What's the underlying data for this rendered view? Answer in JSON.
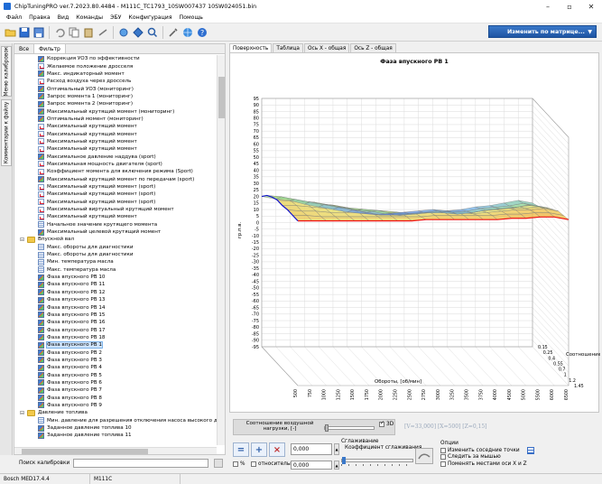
{
  "window": {
    "title": "ChipTuningPRO ver.7.2023.80.4484 - M111C_TC1793_10SW007437 10SW024051.bin"
  },
  "menu": [
    "Файл",
    "Правка",
    "Вид",
    "Команды",
    "ЭБУ",
    "Конфигурация",
    "Помощь"
  ],
  "toolbar": {
    "matrix_button": "Изменить по матрице...",
    "icons": [
      "open-folder-icon",
      "save-icon",
      "save-as-icon",
      "undo-icon",
      "copy-icon",
      "paste-icon",
      "export-icon",
      "compare-icon",
      "checksum-icon",
      "zoom-icon",
      "tools-icon",
      "browser-icon",
      "help-icon"
    ]
  },
  "left_sidebar_tabs": [
    "Меню калибровок",
    "Комментарии к файлу"
  ],
  "left_panel": {
    "tabs": [
      "Все",
      "Фильтр"
    ],
    "search_label": "Поиск калибровки",
    "tree": [
      {
        "label": "Коррекция УОЗ по эффективности",
        "icon": "map",
        "indent": 1
      },
      {
        "label": "Желаемое положение дросселя",
        "icon": "curve",
        "indent": 1
      },
      {
        "label": "Макс. индикаторный момент",
        "icon": "map",
        "indent": 1
      },
      {
        "label": "Расход воздуха через дроссель",
        "icon": "curve",
        "indent": 1
      },
      {
        "label": "Оптимальный УОЗ  (мониторинг)",
        "icon": "map",
        "indent": 1
      },
      {
        "label": "Запрос момента 1 (мониторинг)",
        "icon": "map",
        "indent": 1
      },
      {
        "label": "Запрос момента 2 (мониторинг)",
        "icon": "map",
        "indent": 1
      },
      {
        "label": "Максимальный крутящий момент (мониторинг)",
        "icon": "map",
        "indent": 1
      },
      {
        "label": "Оптимальный момент  (мониторинг)",
        "icon": "map",
        "indent": 1
      },
      {
        "label": "Максимальный крутящий момент",
        "icon": "curve",
        "indent": 1
      },
      {
        "label": "Максимальный крутящий момент",
        "icon": "curve",
        "indent": 1
      },
      {
        "label": "Максимальный крутящий момент",
        "icon": "curve",
        "indent": 1
      },
      {
        "label": "Максимальный крутящий момент",
        "icon": "curve",
        "indent": 1
      },
      {
        "label": "Максимальное давление наддува (sport)",
        "icon": "map",
        "indent": 1
      },
      {
        "label": "Максимальная мощность двигателя (sport)",
        "icon": "curve",
        "indent": 1
      },
      {
        "label": "Коэффициент момента для включения режима (Sport)",
        "icon": "curve",
        "indent": 1
      },
      {
        "label": "Максимальный крутящий момент по передачам (sport)",
        "icon": "map",
        "indent": 1
      },
      {
        "label": "Максимальный крутящий момент (sport)",
        "icon": "curve",
        "indent": 1
      },
      {
        "label": "Максимальный крутящий момент (sport)",
        "icon": "curve",
        "indent": 1
      },
      {
        "label": "Максимальный крутящий момент (sport)",
        "icon": "curve",
        "indent": 1
      },
      {
        "label": "Максимальный виртуальный крутящий момент",
        "icon": "curve",
        "indent": 1
      },
      {
        "label": "Максимальный крутящий момент",
        "icon": "curve",
        "indent": 1
      },
      {
        "label": "Начальное значение крутящего момента",
        "icon": "table",
        "indent": 1
      },
      {
        "label": "Максимальный целевой крутящий момент",
        "icon": "map",
        "indent": 1
      },
      {
        "label": "Впускной вал",
        "icon": "folder",
        "indent": 0
      },
      {
        "label": "Макс. обороты для диагностики",
        "icon": "table",
        "indent": 1
      },
      {
        "label": "Макс. обороты для диагностики",
        "icon": "table",
        "indent": 1
      },
      {
        "label": "Мин. температура масла",
        "icon": "table",
        "indent": 1
      },
      {
        "label": "Макс. температура масла",
        "icon": "table",
        "indent": 1
      },
      {
        "label": "Фаза впускного РВ 10",
        "icon": "map",
        "indent": 1
      },
      {
        "label": "Фаза впускного РВ 11",
        "icon": "map",
        "indent": 1
      },
      {
        "label": "Фаза впускного РВ 12",
        "icon": "map",
        "indent": 1
      },
      {
        "label": "Фаза впускного РВ 13",
        "icon": "map",
        "indent": 1
      },
      {
        "label": "Фаза впускного РВ 14",
        "icon": "map",
        "indent": 1
      },
      {
        "label": "Фаза впускного РВ 15",
        "icon": "map",
        "indent": 1
      },
      {
        "label": "Фаза впускного РВ 16",
        "icon": "map",
        "indent": 1
      },
      {
        "label": "Фаза впускного РВ 17",
        "icon": "map",
        "indent": 1
      },
      {
        "label": "Фаза впускного РВ 18",
        "icon": "map",
        "indent": 1
      },
      {
        "label": "Фаза впускного РВ 1",
        "icon": "map",
        "indent": 1,
        "selected": true
      },
      {
        "label": "Фаза впускного РВ 2",
        "icon": "map",
        "indent": 1
      },
      {
        "label": "Фаза впускного РВ 3",
        "icon": "map",
        "indent": 1
      },
      {
        "label": "Фаза впускного РВ 4",
        "icon": "map",
        "indent": 1
      },
      {
        "label": "Фаза впускного РВ 5",
        "icon": "map",
        "indent": 1
      },
      {
        "label": "Фаза впускного РВ 6",
        "icon": "map",
        "indent": 1
      },
      {
        "label": "Фаза впускного РВ 7",
        "icon": "map",
        "indent": 1
      },
      {
        "label": "Фаза впускного РВ 8",
        "icon": "map",
        "indent": 1
      },
      {
        "label": "Фаза впускного РВ 9",
        "icon": "map",
        "indent": 1
      },
      {
        "label": "Давление топлива",
        "icon": "folder",
        "indent": 0
      },
      {
        "label": "Мин. давление для разрешения отключения насоса высокого да",
        "icon": "table",
        "indent": 1
      },
      {
        "label": "Заданное давление топлива 10",
        "icon": "map",
        "indent": 1
      },
      {
        "label": "Заданное давление топлива 11",
        "icon": "map",
        "indent": 1
      }
    ]
  },
  "view_tabs": [
    "Поверхность",
    "Таблица",
    "Ось X - общая",
    "Ось Z - общая"
  ],
  "chart": {
    "title": "Фаза впускного РВ 1",
    "y_label": "гр.п.в.",
    "x_label": "Обороты, [об/мин]",
    "z_label": "Соотношение в",
    "y_ticks": [
      "95",
      "90",
      "85",
      "80",
      "75",
      "70",
      "65",
      "60",
      "55",
      "50",
      "45",
      "40",
      "35",
      "30",
      "25",
      "20",
      "15",
      "10",
      "5",
      "0",
      "-5",
      "-10",
      "-15",
      "-20",
      "-25",
      "-30",
      "-35",
      "-40",
      "-45",
      "-50",
      "-55",
      "-60",
      "-65",
      "-70",
      "-75",
      "-80",
      "-85",
      "-90",
      "-95"
    ],
    "x_ticks": [
      "500",
      "750",
      "1000",
      "1250",
      "1500",
      "1750",
      "2000",
      "2250",
      "2500",
      "2750",
      "3000",
      "3250",
      "3500",
      "3750",
      "4000",
      "4500",
      "5000",
      "5500",
      "6000",
      "6500"
    ],
    "z_ticks": [
      "1.45",
      "1.2",
      "1",
      "0.7",
      "0.55",
      "0.4",
      "0.25",
      "0.15"
    ]
  },
  "chart_data": {
    "type": "surface",
    "title": "Фаза впускного РВ 1",
    "xlabel": "Обороты, [об/мин]",
    "ylabel": "гр.п.в.",
    "zlabel": "Соотношение в",
    "x": [
      500,
      750,
      1000,
      1250,
      1500,
      1750,
      2000,
      2250,
      2500,
      2750,
      3000,
      3250,
      3500,
      3750,
      4000,
      4500,
      5000,
      5500,
      6000,
      6500
    ],
    "z": [
      0.15,
      0.25,
      0.4,
      0.55,
      0.7,
      1,
      1.2,
      1.45
    ],
    "ylim": [
      -95,
      95
    ],
    "rows": [
      [
        20,
        18,
        17,
        14,
        12,
        10,
        8,
        7,
        6,
        7,
        8,
        9,
        10,
        9,
        10,
        12,
        13,
        15,
        17,
        15
      ],
      [
        25,
        24,
        22,
        20,
        18,
        16,
        14,
        12,
        10,
        10,
        11,
        12,
        13,
        12,
        13,
        15,
        16,
        17,
        19,
        17
      ],
      [
        28,
        27,
        25,
        24,
        22,
        20,
        18,
        17,
        15,
        14,
        15,
        16,
        16,
        15,
        16,
        18,
        19,
        20,
        22,
        20
      ],
      [
        30,
        29,
        28,
        27,
        26,
        24,
        23,
        22,
        20,
        19,
        20,
        21,
        21,
        20,
        21,
        23,
        24,
        25,
        26,
        24
      ],
      [
        30,
        30,
        29,
        28,
        28,
        27,
        26,
        26,
        25,
        24,
        25,
        26,
        26,
        25,
        26,
        27,
        28,
        28,
        29,
        27
      ],
      [
        31,
        30,
        30,
        29,
        29,
        29,
        28,
        28,
        28,
        28,
        29,
        29,
        29,
        28,
        29,
        30,
        31,
        31,
        32,
        30
      ],
      [
        31,
        31,
        30,
        30,
        30,
        30,
        30,
        30,
        30,
        30,
        31,
        31,
        31,
        31,
        31,
        32,
        32,
        33,
        33,
        31
      ],
      [
        31,
        31,
        31,
        31,
        31,
        31,
        31,
        31,
        31,
        32,
        32,
        32,
        32,
        32,
        32,
        33,
        33,
        34,
        34,
        32
      ]
    ],
    "grid": true
  },
  "controls": {
    "ratio_label": "Соотношение воздушной нагрузки, [-]",
    "three_d_label": "3D",
    "three_d_checked": true,
    "coords": "[V=33,000] [X=500] [Z=0,15]",
    "value1": "0,000",
    "value2": "0,000",
    "percent_label": "%",
    "relative_label": "относительно",
    "smoothing_header": "Сглаживание",
    "smoothing_coef": "Коэффициент сглаживания",
    "options_header": "Опции",
    "options": [
      "Изменить соседние точки",
      "Следить за мышью",
      "Поменять местами оси X и Z"
    ]
  },
  "status": [
    "Bosch MED17.4.4",
    "M111C"
  ]
}
